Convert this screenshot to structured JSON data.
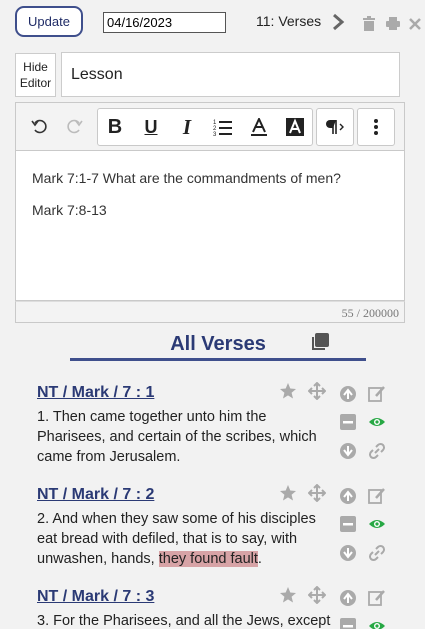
{
  "toolbar_top": {
    "update_label": "Update",
    "date_value": "04/16/2023",
    "verses_label": "11: Verses"
  },
  "editor": {
    "hide_editor_label": "Hide\nEditor",
    "title_value": "Lesson",
    "lines": [
      "Mark 7:1-7 What are the commandments of men?",
      "Mark 7:8-13"
    ],
    "counter": "55 / 200000"
  },
  "all_verses": {
    "title": "All Verses"
  },
  "verses": [
    {
      "ref": "NT / Mark / 7 : 1",
      "text_before": "1. Then came together unto him the Pharisees, and certain of the scribes, which came from Jerusalem.",
      "highlight": "",
      "text_after": ""
    },
    {
      "ref": "NT / Mark / 7 : 2",
      "text_before": "2. And when they saw some of his disciples eat bread with defiled, that is to say, with unwashen, hands, ",
      "highlight": "they found fault",
      "text_after": "."
    },
    {
      "ref": "NT / Mark / 7 : 3",
      "text_before": "3. For the Pharisees, and all the Jews, except",
      "highlight": "",
      "text_after": ""
    }
  ],
  "colors": {
    "accent": "#3f4f8c",
    "link": "#2b3a75",
    "eye": "#27a844",
    "highlight": "#d7a3a6"
  }
}
